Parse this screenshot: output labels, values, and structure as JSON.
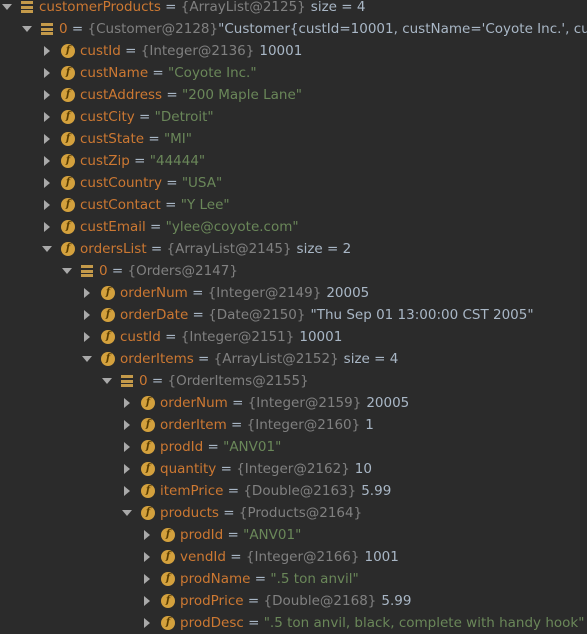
{
  "debugger": {
    "rows": [
      {
        "depth": 0,
        "arrow": "expanded",
        "icon": "list",
        "name": "customerProducts",
        "eq": " = ",
        "ref": "{ArrayList@2125}",
        "value": "size = 4",
        "value_style": "plain"
      },
      {
        "depth": 1,
        "arrow": "expanded",
        "icon": "list",
        "name": "0",
        "eq": " = ",
        "ref": "{Customer@2128}",
        "value": "\"Customer{custId=10001, custName='Coyote Inc.', custAd",
        "value_style": "plain"
      },
      {
        "depth": 2,
        "arrow": "collapsed",
        "icon": "field",
        "name": "custId",
        "eq": " = ",
        "ref": "{Integer@2136}",
        "value": "10001",
        "value_style": "plain"
      },
      {
        "depth": 2,
        "arrow": "collapsed",
        "icon": "field",
        "name": "custName",
        "eq": " = ",
        "ref": "",
        "value": "\"Coyote Inc.\"",
        "value_style": "string"
      },
      {
        "depth": 2,
        "arrow": "collapsed",
        "icon": "field",
        "name": "custAddress",
        "eq": " = ",
        "ref": "",
        "value": "\"200 Maple Lane\"",
        "value_style": "string"
      },
      {
        "depth": 2,
        "arrow": "collapsed",
        "icon": "field",
        "name": "custCity",
        "eq": " = ",
        "ref": "",
        "value": "\"Detroit\"",
        "value_style": "string"
      },
      {
        "depth": 2,
        "arrow": "collapsed",
        "icon": "field",
        "name": "custState",
        "eq": " = ",
        "ref": "",
        "value": "\"MI\"",
        "value_style": "string"
      },
      {
        "depth": 2,
        "arrow": "collapsed",
        "icon": "field",
        "name": "custZip",
        "eq": " = ",
        "ref": "",
        "value": "\"44444\"",
        "value_style": "string"
      },
      {
        "depth": 2,
        "arrow": "collapsed",
        "icon": "field",
        "name": "custCountry",
        "eq": " = ",
        "ref": "",
        "value": "\"USA\"",
        "value_style": "string"
      },
      {
        "depth": 2,
        "arrow": "collapsed",
        "icon": "field",
        "name": "custContact",
        "eq": " = ",
        "ref": "",
        "value": "\"Y Lee\"",
        "value_style": "string"
      },
      {
        "depth": 2,
        "arrow": "collapsed",
        "icon": "field",
        "name": "custEmail",
        "eq": " = ",
        "ref": "",
        "value": "\"ylee@coyote.com\"",
        "value_style": "string"
      },
      {
        "depth": 2,
        "arrow": "expanded",
        "icon": "field",
        "name": "ordersList",
        "eq": " = ",
        "ref": "{ArrayList@2145}",
        "value": "size = 2",
        "value_style": "plain"
      },
      {
        "depth": 3,
        "arrow": "expanded",
        "icon": "list",
        "name": "0",
        "eq": " = ",
        "ref": "{Orders@2147}",
        "value": "",
        "value_style": "plain"
      },
      {
        "depth": 4,
        "arrow": "collapsed",
        "icon": "field",
        "name": "orderNum",
        "eq": " = ",
        "ref": "{Integer@2149}",
        "value": "20005",
        "value_style": "plain"
      },
      {
        "depth": 4,
        "arrow": "collapsed",
        "icon": "field",
        "name": "orderDate",
        "eq": " = ",
        "ref": "{Date@2150}",
        "value": "\"Thu Sep 01 13:00:00 CST 2005\"",
        "value_style": "plain"
      },
      {
        "depth": 4,
        "arrow": "collapsed",
        "icon": "field",
        "name": "custId",
        "eq": " = ",
        "ref": "{Integer@2151}",
        "value": "10001",
        "value_style": "plain"
      },
      {
        "depth": 4,
        "arrow": "expanded",
        "icon": "field",
        "name": "orderItems",
        "eq": " = ",
        "ref": "{ArrayList@2152}",
        "value": "size = 4",
        "value_style": "plain"
      },
      {
        "depth": 5,
        "arrow": "expanded",
        "icon": "list",
        "name": "0",
        "eq": " = ",
        "ref": "{OrderItems@2155}",
        "value": "",
        "value_style": "plain"
      },
      {
        "depth": 6,
        "arrow": "collapsed",
        "icon": "field",
        "name": "orderNum",
        "eq": " = ",
        "ref": "{Integer@2159}",
        "value": "20005",
        "value_style": "plain"
      },
      {
        "depth": 6,
        "arrow": "collapsed",
        "icon": "field",
        "name": "orderItem",
        "eq": " = ",
        "ref": "{Integer@2160}",
        "value": "1",
        "value_style": "plain"
      },
      {
        "depth": 6,
        "arrow": "collapsed",
        "icon": "field",
        "name": "prodId",
        "eq": " = ",
        "ref": "",
        "value": "\"ANV01\"",
        "value_style": "string"
      },
      {
        "depth": 6,
        "arrow": "collapsed",
        "icon": "field",
        "name": "quantity",
        "eq": " = ",
        "ref": "{Integer@2162}",
        "value": "10",
        "value_style": "plain"
      },
      {
        "depth": 6,
        "arrow": "collapsed",
        "icon": "field",
        "name": "itemPrice",
        "eq": " = ",
        "ref": "{Double@2163}",
        "value": "5.99",
        "value_style": "plain"
      },
      {
        "depth": 6,
        "arrow": "expanded",
        "icon": "field",
        "name": "products",
        "eq": " = ",
        "ref": "{Products@2164}",
        "value": "",
        "value_style": "plain"
      },
      {
        "depth": 7,
        "arrow": "collapsed",
        "icon": "field",
        "name": "prodId",
        "eq": " = ",
        "ref": "",
        "value": "\"ANV01\"",
        "value_style": "string"
      },
      {
        "depth": 7,
        "arrow": "collapsed",
        "icon": "field",
        "name": "vendId",
        "eq": " = ",
        "ref": "{Integer@2166}",
        "value": "1001",
        "value_style": "plain"
      },
      {
        "depth": 7,
        "arrow": "collapsed",
        "icon": "field",
        "name": "prodName",
        "eq": " = ",
        "ref": "",
        "value": "\".5 ton anvil\"",
        "value_style": "string"
      },
      {
        "depth": 7,
        "arrow": "collapsed",
        "icon": "field",
        "name": "prodPrice",
        "eq": " = ",
        "ref": "{Double@2168}",
        "value": "5.99",
        "value_style": "plain"
      },
      {
        "depth": 7,
        "arrow": "collapsed",
        "icon": "field",
        "name": "prodDesc",
        "eq": " = ",
        "ref": "",
        "value": "\".5 ton anvil, black, complete with handy hook\"",
        "value_style": "string"
      }
    ]
  },
  "icons": {
    "list": "list-icon",
    "field": "field-icon",
    "expanded": "chevron-down-icon",
    "collapsed": "chevron-right-icon"
  },
  "colors": {
    "background": "#2b2b2b",
    "name": "#cc7832",
    "reference": "#808080",
    "string": "#6a8759",
    "value": "#a9b7c6",
    "field_icon": "#d4a13d"
  }
}
